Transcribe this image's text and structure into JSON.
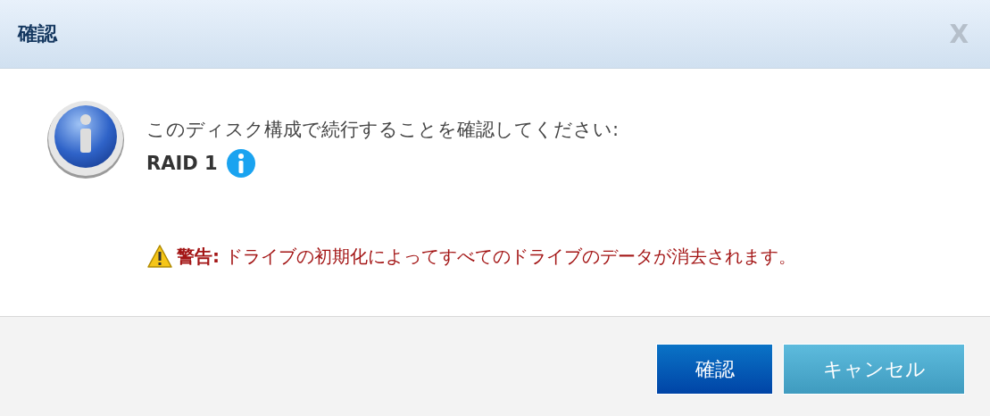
{
  "dialog": {
    "title": "確認",
    "close": "X"
  },
  "message": "このディスク構成で続行することを確認してください:",
  "raid": "RAID 1",
  "warning": "**警告:** ドライブの初期化によってすべてのドライブのデータが消去されます。",
  "buttons": [
    {
      "label": "確認",
      "kind": "primary"
    },
    {
      "label": "キャンセル",
      "kind": "secondary"
    }
  ]
}
